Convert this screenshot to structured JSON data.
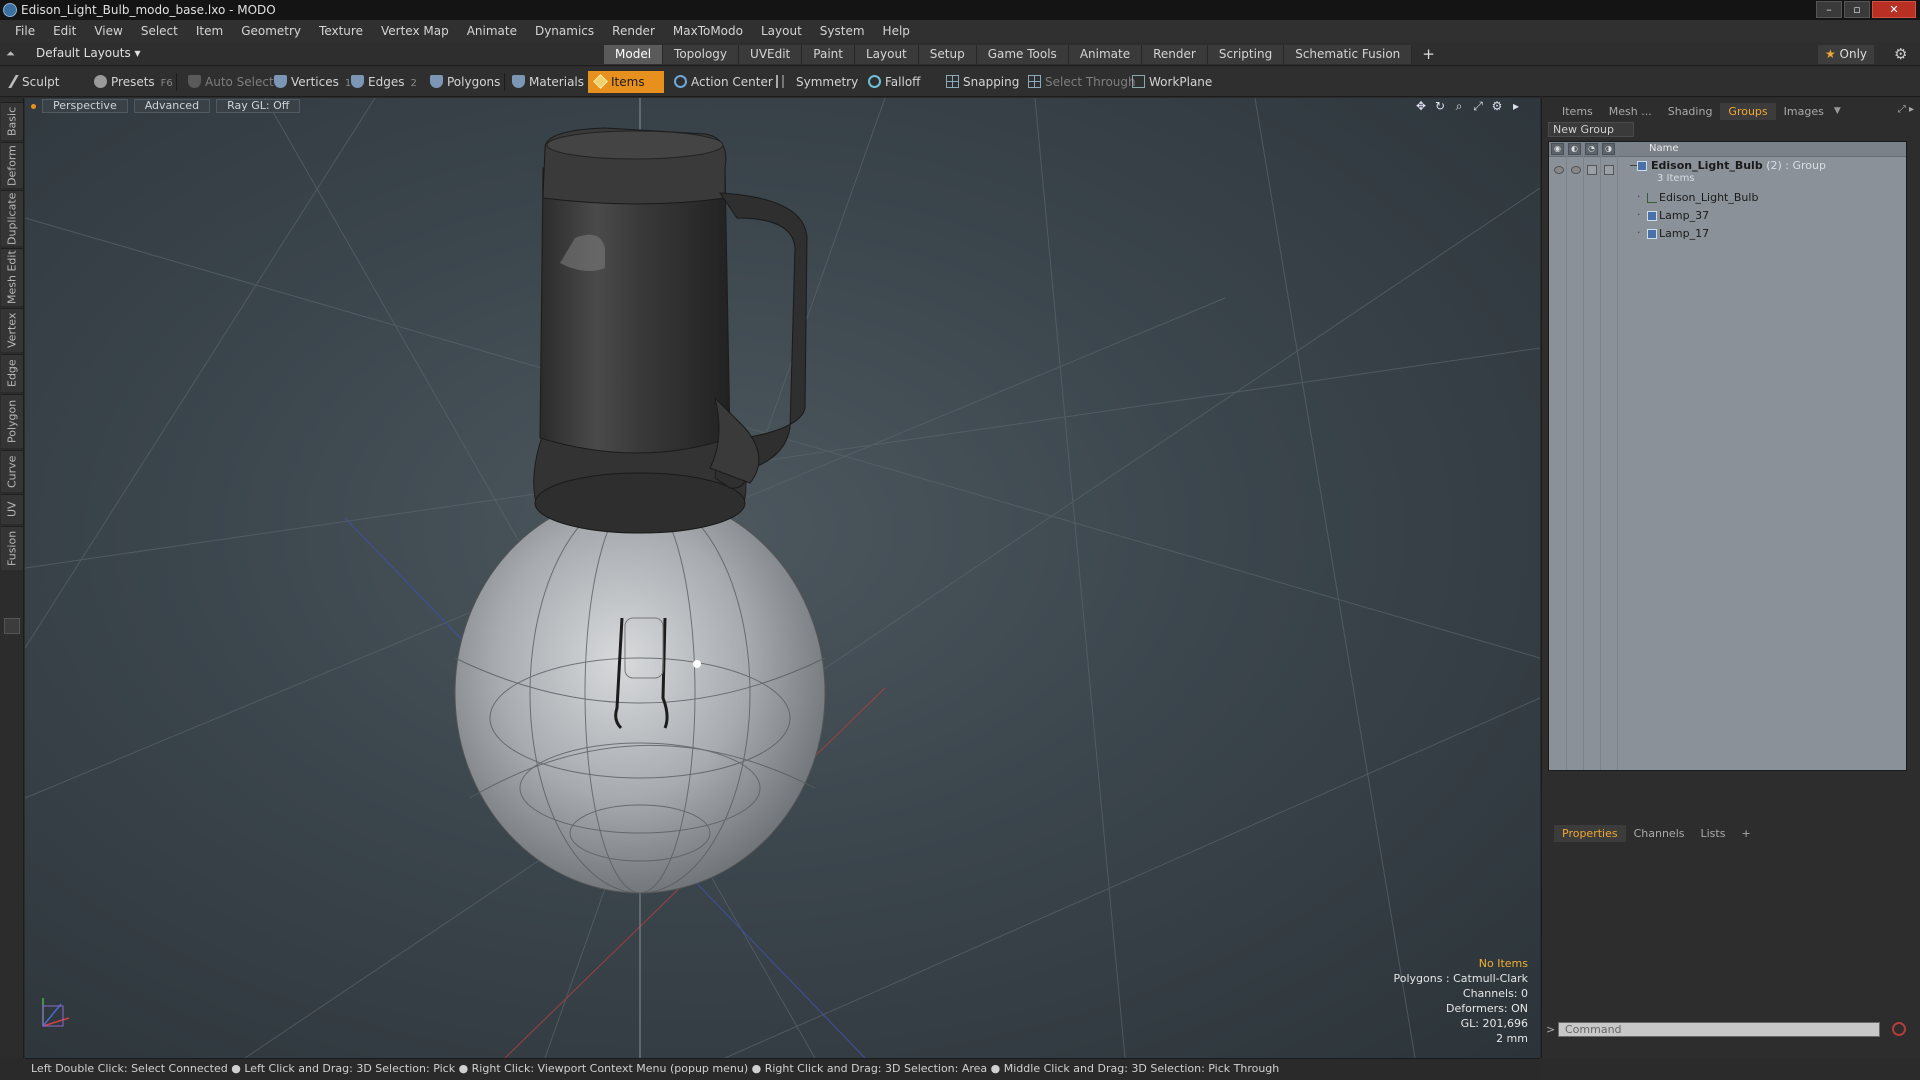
{
  "window": {
    "title": "Edison_Light_Bulb_modo_base.lxo - MODO",
    "controls": [
      "–",
      "▫",
      "✕"
    ]
  },
  "menu": [
    "File",
    "Edit",
    "View",
    "Select",
    "Item",
    "Geometry",
    "Texture",
    "Vertex Map",
    "Animate",
    "Dynamics",
    "Render",
    "MaxToModo",
    "Layout",
    "System",
    "Help"
  ],
  "layout_bar": {
    "layouts_dropdown": "Default Layouts ▾",
    "tabs": [
      "Model",
      "Topology",
      "UVEdit",
      "Paint",
      "Layout",
      "Setup",
      "Game Tools",
      "Animate",
      "Render",
      "Scripting",
      "Schematic Fusion"
    ],
    "active_tab": "Model",
    "add": "+",
    "only_label": "Only",
    "only_star": "★"
  },
  "toolbar": {
    "sculpt": "Sculpt",
    "presets": "Presets",
    "presets_key": "F6",
    "auto_select": "Auto Select",
    "vertices": "Vertices",
    "vertices_count": "1",
    "edges": "Edges",
    "edges_count": "2",
    "polygons": "Polygons",
    "materials": "Materials",
    "items": "Items",
    "action_center": "Action Center",
    "symmetry": "Symmetry",
    "falloff": "Falloff",
    "snapping": "Snapping",
    "select_through": "Select Through",
    "workplane": "WorkPlane"
  },
  "left_tabs": [
    "Basic",
    "Deform",
    "Duplicate",
    "Mesh Edit",
    "Vertex",
    "Edge",
    "Polygon",
    "Curve",
    "UV",
    "Fusion"
  ],
  "viewport": {
    "view_mode": "Perspective",
    "shading": "Advanced",
    "raygl": "Ray GL: Off",
    "info": {
      "selection": "No Items",
      "polygons": "Polygons : Catmull-Clark",
      "channels": "Channels: 0",
      "deformers": "Deformers: ON",
      "gl": "GL: 201,696",
      "grid": "2 mm"
    }
  },
  "right_panel": {
    "tabs": [
      "Items",
      "Mesh ...",
      "Shading",
      "Groups",
      "Images"
    ],
    "active_tab": "Groups",
    "new_group": "New Group",
    "column_name": "Name",
    "group": {
      "name": "Edison_Light_Bulb",
      "count": "(2)",
      "type": ": Group",
      "items_count": "3 Items",
      "children": [
        "Edison_Light_Bulb",
        "Lamp_37",
        "Lamp_17"
      ]
    },
    "bottom_tabs": [
      "Properties",
      "Channels",
      "Lists"
    ],
    "bottom_active": "Properties",
    "bottom_add": "+",
    "command_placeholder": "Command"
  },
  "status_bar": "Left Double Click: Select Connected ● Left Click and Drag: 3D Selection: Pick ● Right Click: Viewport Context Menu (popup menu) ● Right Click and Drag: 3D Selection: Area ● Middle Click and Drag: 3D Selection: Pick Through",
  "colors": {
    "accent": "#e8901e",
    "active_tab_text": "#f0a830",
    "viewport_bg": "#3b454c",
    "group_list_bg": "#8b9199"
  }
}
